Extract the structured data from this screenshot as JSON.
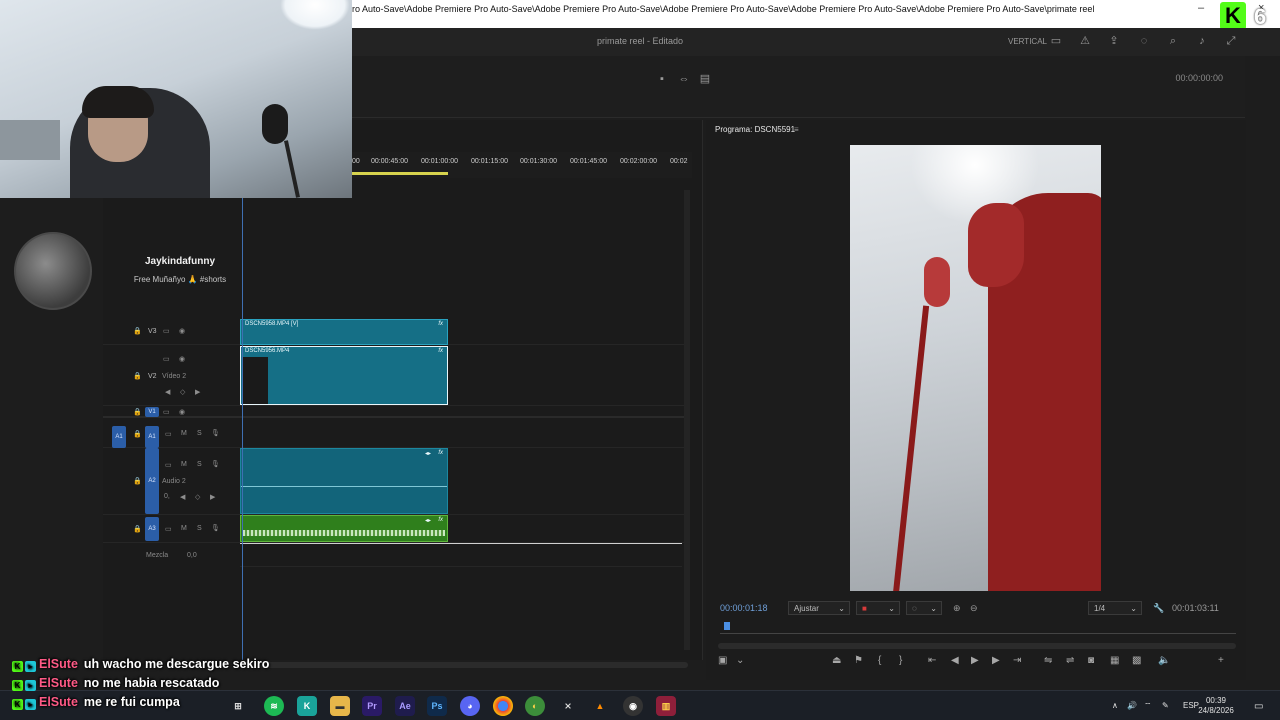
{
  "window": {
    "title_path": "ro Auto-Save\\Adobe Premiere Pro Auto-Save\\Adobe Premiere Pro Auto-Save\\Adobe Premiere Pro Auto-Save\\Adobe Premiere Pro Auto-Save\\Adobe Premiere Pro Auto-Save\\primate reel",
    "minimize": "–",
    "close": "×"
  },
  "kick_overlay": {
    "logo": "K",
    "count": "6"
  },
  "header": {
    "project": "primate reel - Editado",
    "workspace": "VERTICAL"
  },
  "source_monitor": {
    "timecode": "00:00:00:00"
  },
  "channel": {
    "name": "Jaykindafunny",
    "status": "Free Muñañyo 🙏 #shorts"
  },
  "timeline": {
    "ruler_ticks": [
      "00",
      "00:00:45:00",
      "00:01:00:00",
      "00:01:15:00",
      "00:01:30:00",
      "00:01:45:00",
      "00:02:00:00",
      "00:02"
    ],
    "tracks": {
      "v3": {
        "label": "V3"
      },
      "v2": {
        "label": "V2",
        "name": "Vídeo 2"
      },
      "v1": {
        "label": "V1"
      },
      "a1": {
        "label": "A1",
        "source": "A1"
      },
      "a2": {
        "label": "A2",
        "name": "Audio 2",
        "level": "0,"
      },
      "a3": {
        "label": "A3"
      },
      "mix": {
        "label": "Mezcla",
        "value": "0,0"
      }
    },
    "clips": {
      "v3_clip": {
        "name": "DSCN5958.MP4 [V]",
        "fx": "fx"
      },
      "v2_clip": {
        "name": "DSCN5956.MP4",
        "fx": "fx"
      },
      "a2_clip": {
        "fx": "fx"
      },
      "a3_clip": {
        "fx": "fx"
      }
    },
    "track_ms": {
      "m": "M",
      "s": "S"
    }
  },
  "program_monitor": {
    "title": "Programa: DSCN5591",
    "current_tc": "00:00:01:18",
    "fit": "Ajustar",
    "resolution": "1/4",
    "duration_tc": "00:01:03:11"
  },
  "chat": [
    {
      "user": "ElSute",
      "message": "uh wacho me descargue sekiro"
    },
    {
      "user": "ElSute",
      "message": "no me habia rescatado"
    },
    {
      "user": "ElSute",
      "message": "me re fui cumpa"
    }
  ],
  "taskbar": {
    "apps": [
      "Pr",
      "Ae",
      "Ps"
    ],
    "lang": "ESP",
    "time": "00:39",
    "date": "24/8/2026"
  }
}
